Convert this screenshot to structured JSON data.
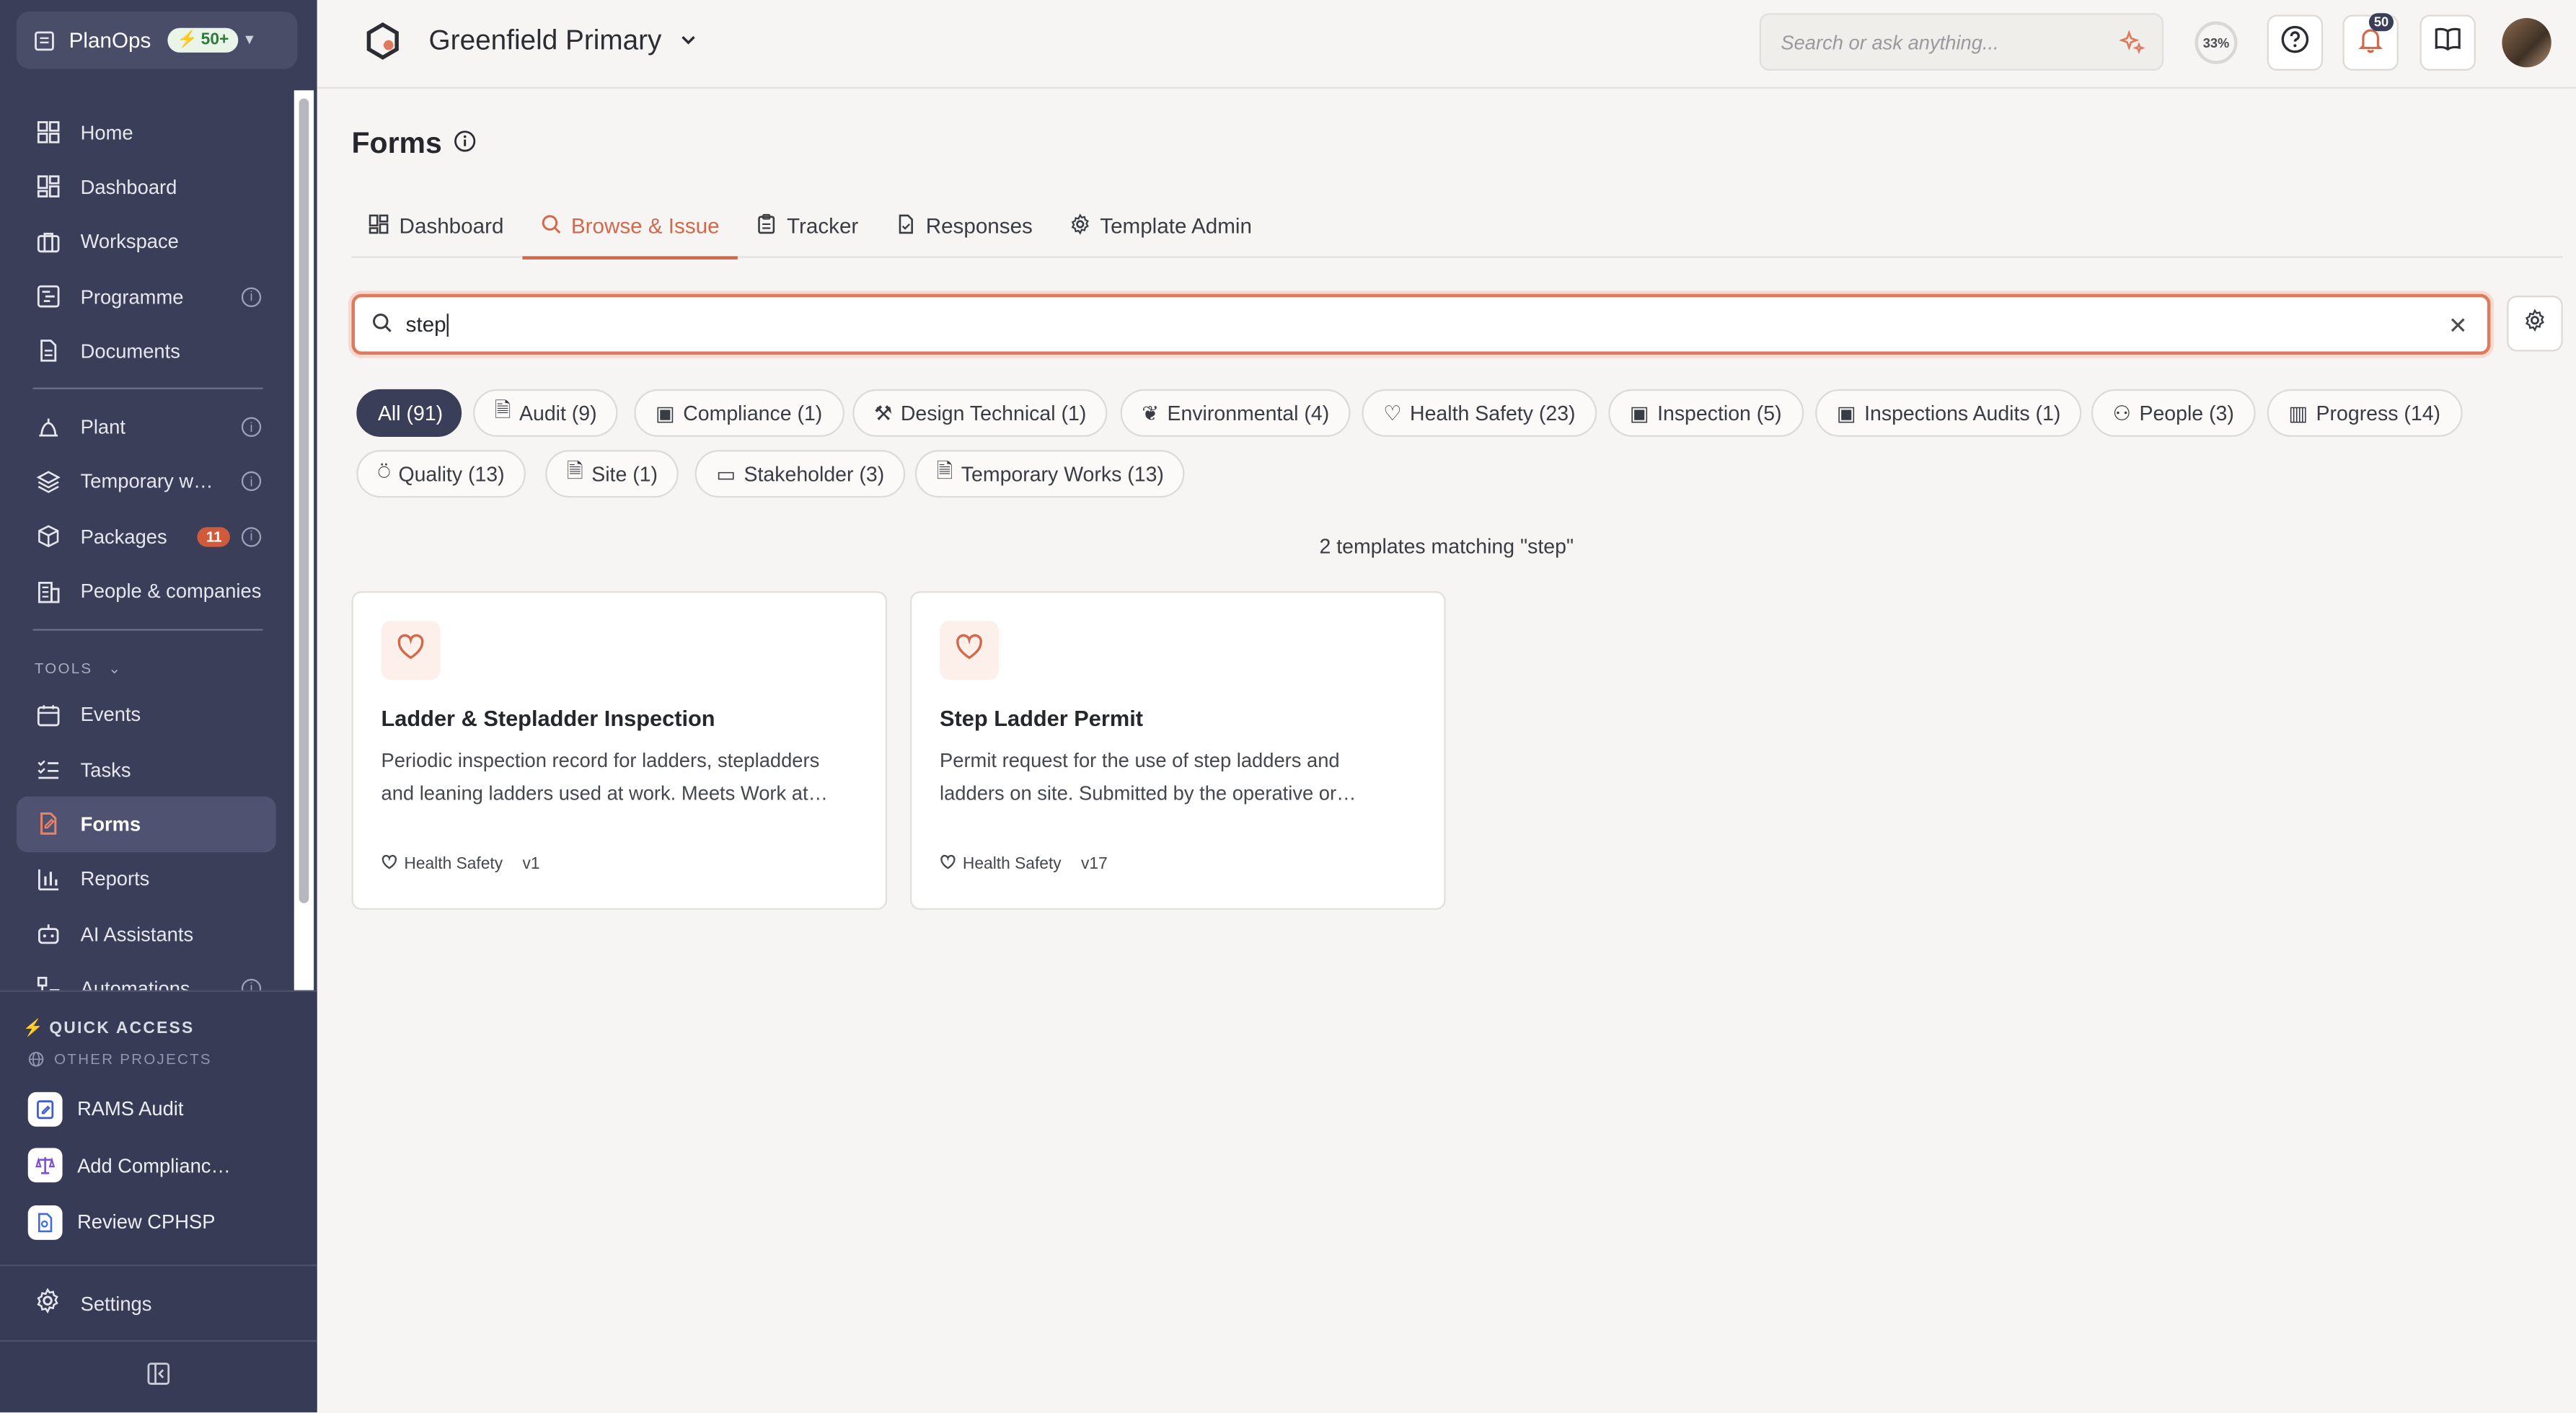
{
  "workspace": {
    "name": "PlanOps",
    "badge": "50+"
  },
  "sidebar": {
    "items": [
      {
        "label": "Home",
        "icon": "grid-icon"
      },
      {
        "label": "Dashboard",
        "icon": "dashboard-icon"
      },
      {
        "label": "Workspace",
        "icon": "briefcase-icon"
      },
      {
        "label": "Programme",
        "icon": "gantt-icon"
      },
      {
        "label": "Documents",
        "icon": "document-icon"
      },
      {
        "label": "Plant",
        "icon": "plant-icon"
      },
      {
        "label": "Temporary w…",
        "icon": "layers-icon"
      },
      {
        "label": "Packages",
        "icon": "package-icon",
        "count": "11"
      },
      {
        "label": "People & companies",
        "icon": "building-icon"
      }
    ],
    "tools_label": "TOOLS",
    "tools": [
      {
        "label": "Events",
        "icon": "calendar-icon"
      },
      {
        "label": "Tasks",
        "icon": "checklist-icon"
      },
      {
        "label": "Forms",
        "icon": "form-icon"
      },
      {
        "label": "Reports",
        "icon": "bar-chart-icon"
      },
      {
        "label": "AI Assistants",
        "icon": "robot-icon"
      },
      {
        "label": "Automations",
        "icon": "workflow-icon"
      }
    ],
    "quick_access": "QUICK ACCESS",
    "other_projects": "OTHER PROJECTS",
    "quick_items": [
      {
        "label": "RAMS Audit"
      },
      {
        "label": "Add Complianc…"
      },
      {
        "label": "Review CPHSP"
      }
    ],
    "settings": "Settings"
  },
  "header": {
    "project": "Greenfield Primary",
    "search_placeholder": "Search or ask anything...",
    "progress": "33%",
    "notifications": "50"
  },
  "page": {
    "title": "Forms",
    "tabs": [
      {
        "label": "Dashboard"
      },
      {
        "label": "Browse & Issue"
      },
      {
        "label": "Tracker"
      },
      {
        "label": "Responses"
      },
      {
        "label": "Template Admin"
      }
    ],
    "search_value": "step",
    "filters": [
      {
        "label": "All (91)"
      },
      {
        "label": "Audit (9)"
      },
      {
        "label": "Compliance (1)"
      },
      {
        "label": "Design Technical (1)"
      },
      {
        "label": "Environmental (4)"
      },
      {
        "label": "Health Safety (23)"
      },
      {
        "label": "Inspection (5)"
      },
      {
        "label": "Inspections Audits (1)"
      },
      {
        "label": "People (3)"
      },
      {
        "label": "Progress (14)"
      },
      {
        "label": "Quality (13)"
      },
      {
        "label": "Site (1)"
      },
      {
        "label": "Stakeholder (3)"
      },
      {
        "label": "Temporary Works (13)"
      }
    ],
    "match_text": "2 templates matching \"step\"",
    "cards": [
      {
        "title": "Ladder & Stepladder Inspection",
        "desc_line1": "Periodic inspection record for ladders, stepladders",
        "desc_line2": "and leaning ladders used at work. Meets Work at…",
        "category": "Health Safety",
        "version": "v1"
      },
      {
        "title": "Step Ladder Permit",
        "desc_line1": "Permit request for the use of step ladders and",
        "desc_line2": "ladders on site. Submitted by the operative or…",
        "category": "Health Safety",
        "version": "v17"
      }
    ]
  },
  "colors": {
    "sidebar": "#3b3e58",
    "accent": "#d2694d",
    "active_chip": "#3b3e58"
  }
}
